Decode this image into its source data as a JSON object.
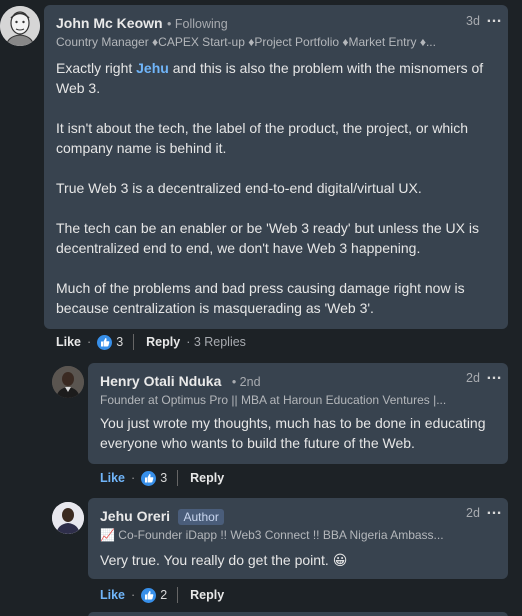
{
  "comment_main": {
    "name": "John Mc Keown",
    "connection": "• Following",
    "headline": "Country Manager ♦CAPEX Start-up ♦Project Portfolio ♦Market Entry ♦...",
    "time": "3d",
    "body": {
      "p1_pre": "Exactly right ",
      "p1_mention": "Jehu",
      "p1_post": " and this is also the problem with the misnomers of Web 3.",
      "p2": "It isn't about the tech, the label of the product, the project, or which company name is behind it.",
      "p3": "True Web 3 is a decentralized end-to-end digital/virtual UX.",
      "p4": "The tech can be an enabler or be 'Web 3 ready' but unless the UX is decentralized end to end, we don't have Web 3 happening.",
      "p5": "Much of the problems and bad press causing damage right now is because centralization is masquerading as 'Web 3'."
    },
    "like_label": "Like",
    "like_count": "3",
    "reply_label": "Reply",
    "replies_text": "· 3 Replies"
  },
  "reply_1": {
    "name": "Henry Otali Nduka",
    "connection": "• 2nd",
    "headline": "Founder at Optimus Pro || MBA at Haroun Education Ventures |...",
    "time": "2d",
    "body": "You just wrote my thoughts, much has to be done in educating everyone who wants to build the future of the Web.",
    "like_label": "Like",
    "like_count": "3",
    "reply_label": "Reply"
  },
  "reply_2": {
    "name": "Jehu Oreri",
    "badge": "Author",
    "headline": "📈 Co-Founder iDapp !! Web3 Connect !! BBA Nigeria Ambass...",
    "time": "2d",
    "body": "Very true. You really do get the point. 😀",
    "like_label": "Like",
    "like_count": "2",
    "reply_label": "Reply"
  },
  "more_icon": "…",
  "colors": {
    "background": "#1d2226",
    "bubble": "#38434f",
    "link": "#70b5f9",
    "reaction": "#378fe9"
  }
}
